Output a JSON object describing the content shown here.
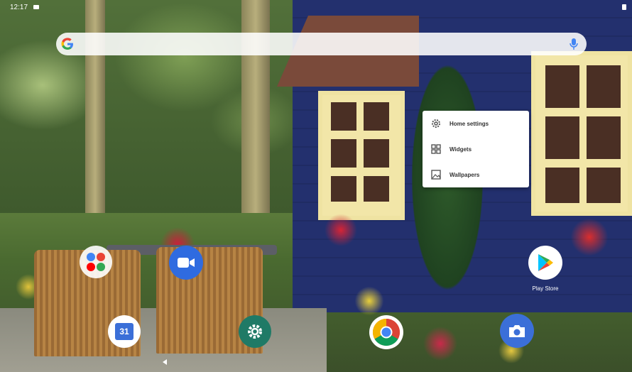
{
  "status_bar": {
    "time": "12:17"
  },
  "search": {
    "placeholder": ""
  },
  "context_menu": {
    "items": [
      {
        "label": "Home settings",
        "icon": "gear-icon"
      },
      {
        "label": "Widgets",
        "icon": "widgets-grid-icon"
      },
      {
        "label": "Wallpapers",
        "icon": "wallpaper-icon"
      }
    ]
  },
  "home_apps": [
    {
      "name": "google-apps-folder",
      "label": ""
    },
    {
      "name": "duo-video",
      "label": ""
    },
    {
      "name": "calendar",
      "label": "",
      "badge": "31"
    },
    {
      "name": "settings",
      "label": ""
    },
    {
      "name": "chrome",
      "label": ""
    },
    {
      "name": "camera",
      "label": ""
    },
    {
      "name": "play-store",
      "label": "Play Store"
    }
  ],
  "colors": {
    "house_blue": "#23306e",
    "window_yellow": "#f2e6a8",
    "accent_blue": "#3b6fd8"
  }
}
